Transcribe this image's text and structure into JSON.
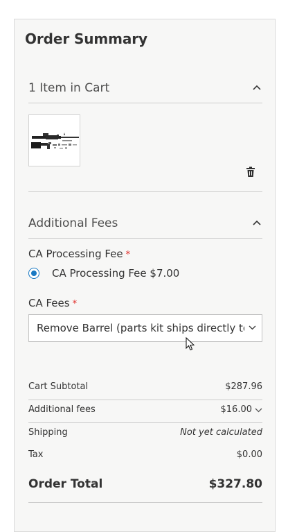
{
  "summary": {
    "title": "Order Summary"
  },
  "cart": {
    "header": "1 Item in Cart",
    "product_image_icon": "rifle-parts-kit-image",
    "delete_icon": "trash-icon"
  },
  "fees": {
    "header": "Additional Fees",
    "processing": {
      "label": "CA Processing Fee",
      "required_mark": "*",
      "option_label": "CA Processing Fee $7.00",
      "selected": true
    },
    "ca_fees": {
      "label": "CA Fees",
      "required_mark": "*",
      "selected_value": "Remove Barrel (parts kit ships directly to"
    }
  },
  "totals": {
    "subtotal_label": "Cart Subtotal",
    "subtotal_value": "$287.96",
    "fees_label": "Additional fees",
    "fees_value": "$16.00",
    "shipping_label": "Shipping",
    "shipping_value": "Not yet calculated",
    "tax_label": "Tax",
    "tax_value": "$0.00",
    "order_total_label": "Order Total",
    "order_total_value": "$327.80"
  },
  "colors": {
    "accent": "#1979c3",
    "required": "#e02b27",
    "panel_bg": "#f7f7f6"
  }
}
